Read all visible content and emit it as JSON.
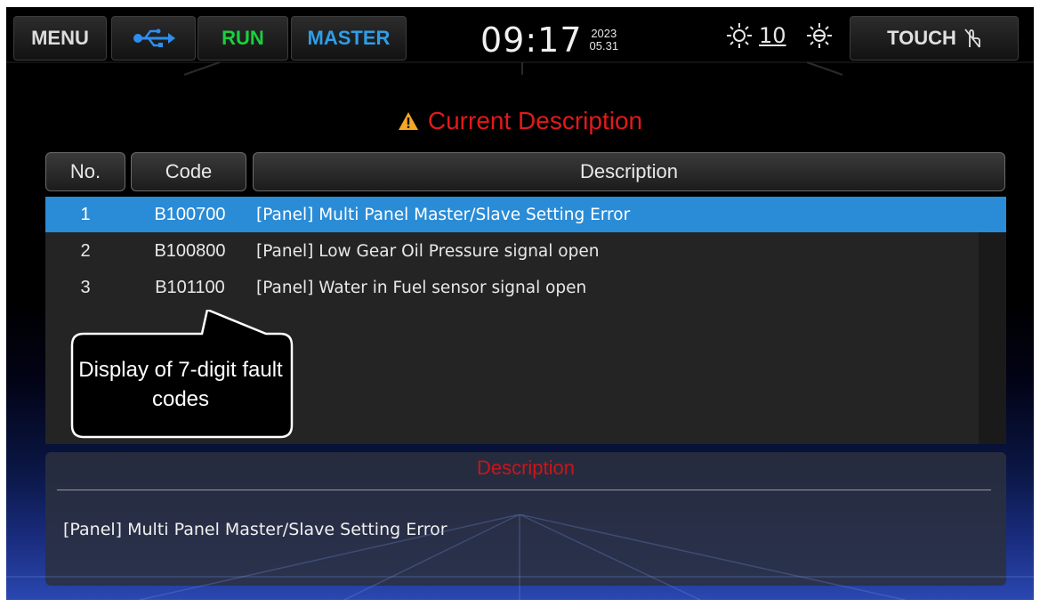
{
  "topbar": {
    "menu_label": "MENU",
    "usb_icon": "usb-icon",
    "run_label": "RUN",
    "master_label": "MASTER",
    "time": "09:17",
    "year": "2023",
    "date": "05.31",
    "brightness_value": "10",
    "touch_label": "TOUCH",
    "colors": {
      "run": "#19d03d",
      "master": "#2e9ee8"
    }
  },
  "main": {
    "title": "Current Description",
    "warning_icon": "warning-icon",
    "title_color": "#e21a1a"
  },
  "table": {
    "headers": {
      "no": "No.",
      "code": "Code",
      "description": "Description"
    },
    "rows": [
      {
        "no": "1",
        "code": "B100700",
        "description": "[Panel] Multi Panel Master/Slave Setting Error",
        "selected": true
      },
      {
        "no": "2",
        "code": "B100800",
        "description": "[Panel] Low Gear Oil Pressure signal open",
        "selected": false
      },
      {
        "no": "3",
        "code": "B101100",
        "description": "[Panel] Water in Fuel sensor signal open",
        "selected": false
      }
    ],
    "selected_color": "#2a8bd6"
  },
  "callout": {
    "text": "Display of 7-digit fault codes"
  },
  "detail": {
    "title": "Description",
    "text": "[Panel] Multi Panel Master/Slave Setting Error"
  }
}
